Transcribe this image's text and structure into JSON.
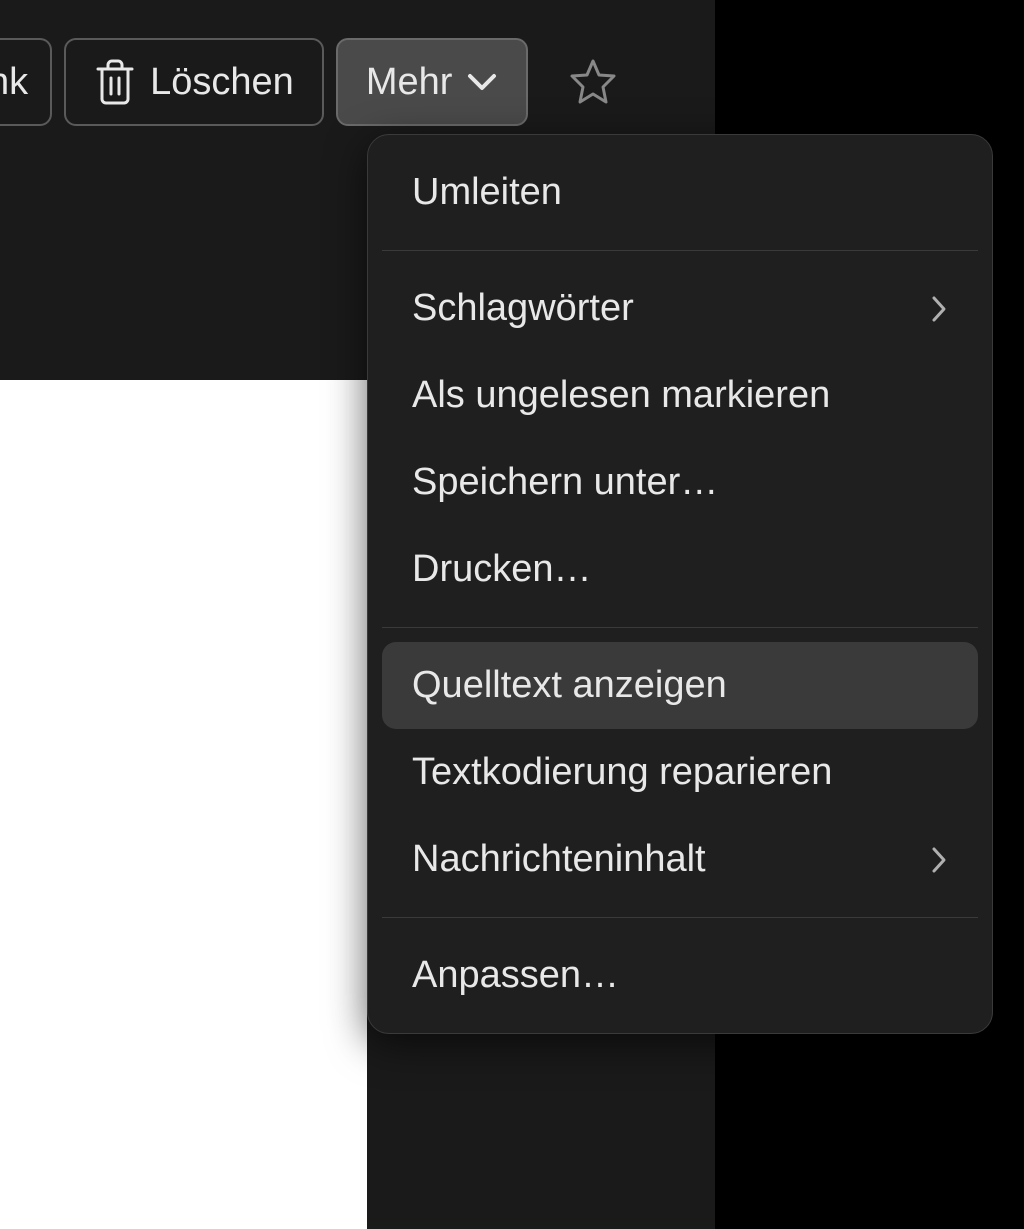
{
  "toolbar": {
    "partial_button_suffix": "nk",
    "delete_label": "Löschen",
    "more_label": "Mehr"
  },
  "menu": {
    "redirect": "Umleiten",
    "tags": "Schlagwörter",
    "mark_unread": "Als ungelesen markieren",
    "save_as": "Speichern unter…",
    "print": "Drucken…",
    "view_source": "Quelltext anzeigen",
    "repair_encoding": "Textkodierung reparieren",
    "message_content": "Nachrichteninhalt",
    "customize": "Anpassen…"
  },
  "colors": {
    "bg_dark": "#1a1a1a",
    "bg_black": "#000000",
    "bg_white": "#ffffff",
    "menu_bg": "#1f1f1f",
    "hover_bg": "#3a3a3a",
    "text": "#e8e8e8",
    "border": "#5a5a5a"
  }
}
